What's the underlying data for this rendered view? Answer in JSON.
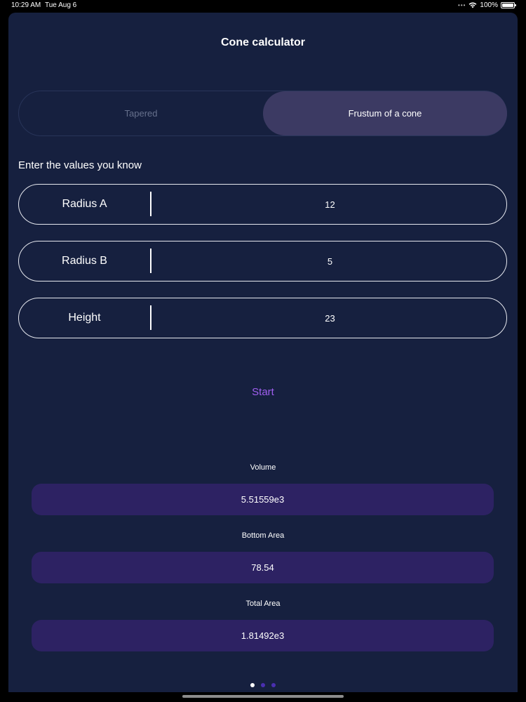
{
  "status_bar": {
    "time": "10:29 AM",
    "date": "Tue Aug 6",
    "battery": "100%"
  },
  "header": {
    "title": "Cone calculator"
  },
  "segments": {
    "options": [
      "Tapered",
      "Frustum of a cone"
    ],
    "selected": "Frustum of a cone"
  },
  "prompt": "Enter the values you know",
  "fields": [
    {
      "label": "Radius A",
      "value": "12"
    },
    {
      "label": "Radius B",
      "value": "5"
    },
    {
      "label": "Height",
      "value": "23"
    }
  ],
  "start_label": "Start",
  "results": [
    {
      "label": "Volume",
      "value": "5.51559e3"
    },
    {
      "label": "Bottom Area",
      "value": "78.54"
    },
    {
      "label": "Total Area",
      "value": "1.81492e3"
    }
  ],
  "pager": {
    "count": 3,
    "current": 1
  },
  "colors": {
    "background": "#16203f",
    "accent": "#a05ff0",
    "result_box": "#2d2263",
    "selected_segment": "#3c3a63"
  }
}
